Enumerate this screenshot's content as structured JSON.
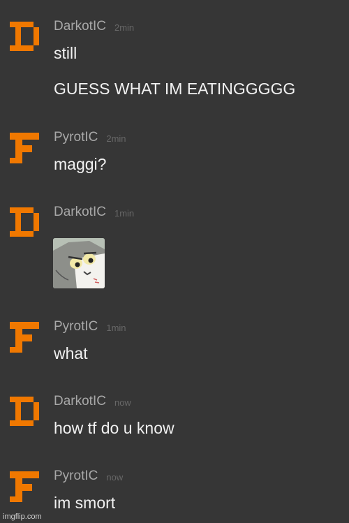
{
  "messages": [
    {
      "author": "DarkotIC",
      "time": "2min",
      "avatar_icon": "orange-pixel-D-icon",
      "lines": [
        "still",
        "GUESS WHAT IM EATINGGGGG"
      ]
    },
    {
      "author": "PyrotIC",
      "time": "2min",
      "avatar_icon": "orange-pixel-F-icon",
      "lines": [
        "maggi?"
      ]
    },
    {
      "author": "DarkotIC",
      "time": "1min",
      "avatar_icon": "orange-pixel-D-icon",
      "attachment": "cartoon-cat-meme-image"
    },
    {
      "author": "PyrotIC",
      "time": "1min",
      "avatar_icon": "orange-pixel-F-icon",
      "lines": [
        "what"
      ]
    },
    {
      "author": "DarkotIC",
      "time": "now",
      "avatar_icon": "orange-pixel-D-icon",
      "lines": [
        "how tf do u know"
      ]
    },
    {
      "author": "PyrotIC",
      "time": "now",
      "avatar_icon": "orange-pixel-F-icon",
      "lines": [
        "im smort"
      ]
    }
  ],
  "watermark": "imgflip.com",
  "colors": {
    "background": "#363636",
    "avatar_orange": "#f07800",
    "username": "#a8a8a8",
    "timestamp": "#686868",
    "message_text": "#f1f1f1"
  }
}
